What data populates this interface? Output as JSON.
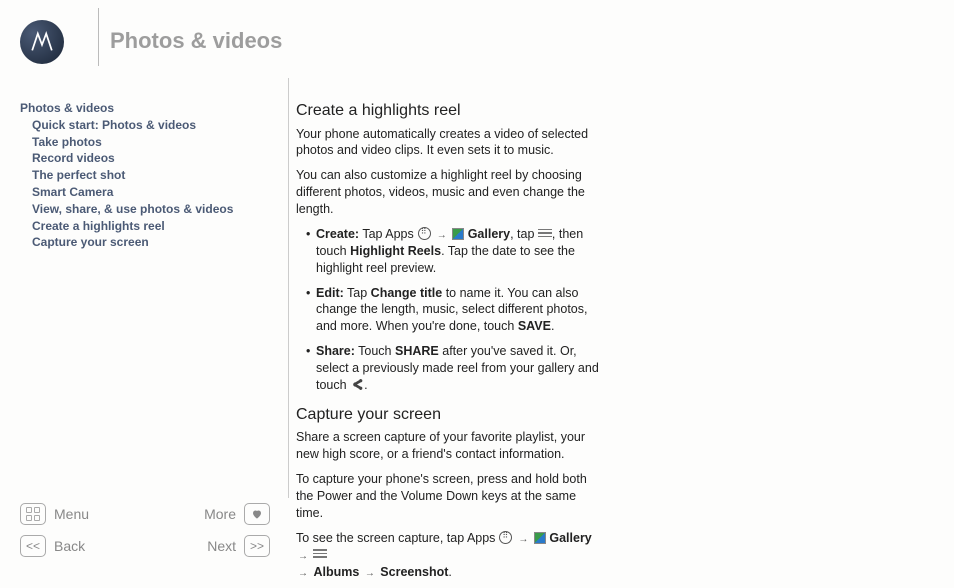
{
  "header": {
    "title": "Photos & videos"
  },
  "sidebar": {
    "head": "Photos & videos",
    "items": [
      "Quick start: Photos & videos",
      "Take photos",
      "Record videos",
      "The perfect shot",
      "Smart Camera",
      "View, share, & use photos & videos",
      "Create a highlights reel",
      "Capture your screen"
    ]
  },
  "content": {
    "h1": "Create a highlights reel",
    "p1": "Your phone automatically creates a video of selected photos and video clips. It even sets it to music.",
    "p2": "You can also customize a highlight reel by choosing different photos, videos, music and even change the length.",
    "li1_label": "Create:",
    "li1_a": "Tap Apps",
    "li1_b": "Gallery",
    "li1_c": ", tap",
    "li1_d": ", then touch",
    "li1_e": "Highlight Reels",
    "li1_f": ". Tap the date to see the highlight reel preview.",
    "li2_label": "Edit:",
    "li2_a": "Tap",
    "li2_b": "Change title",
    "li2_c": "to name it. You can also change the length, music, select different photos, and more. When you're done, touch",
    "li2_d": "SAVE",
    "li3_label": "Share:",
    "li3_a": "Touch",
    "li3_b": "SHARE",
    "li3_c": "after you've saved it. Or, select a previously made reel from your gallery and touch",
    "h2": "Capture your screen",
    "p3": "Share a screen capture of your favorite playlist, your new high score, or a friend's contact information.",
    "p4": "To capture your phone's screen, press and hold both the Power and the Volume Down keys at the same time.",
    "p5_a": "To see the screen capture, tap Apps",
    "p5_b": "Gallery",
    "p5_c": "Albums",
    "p5_d": "Screenshot"
  },
  "nav": {
    "menu": "Menu",
    "more": "More",
    "back": "Back",
    "next": "Next"
  }
}
